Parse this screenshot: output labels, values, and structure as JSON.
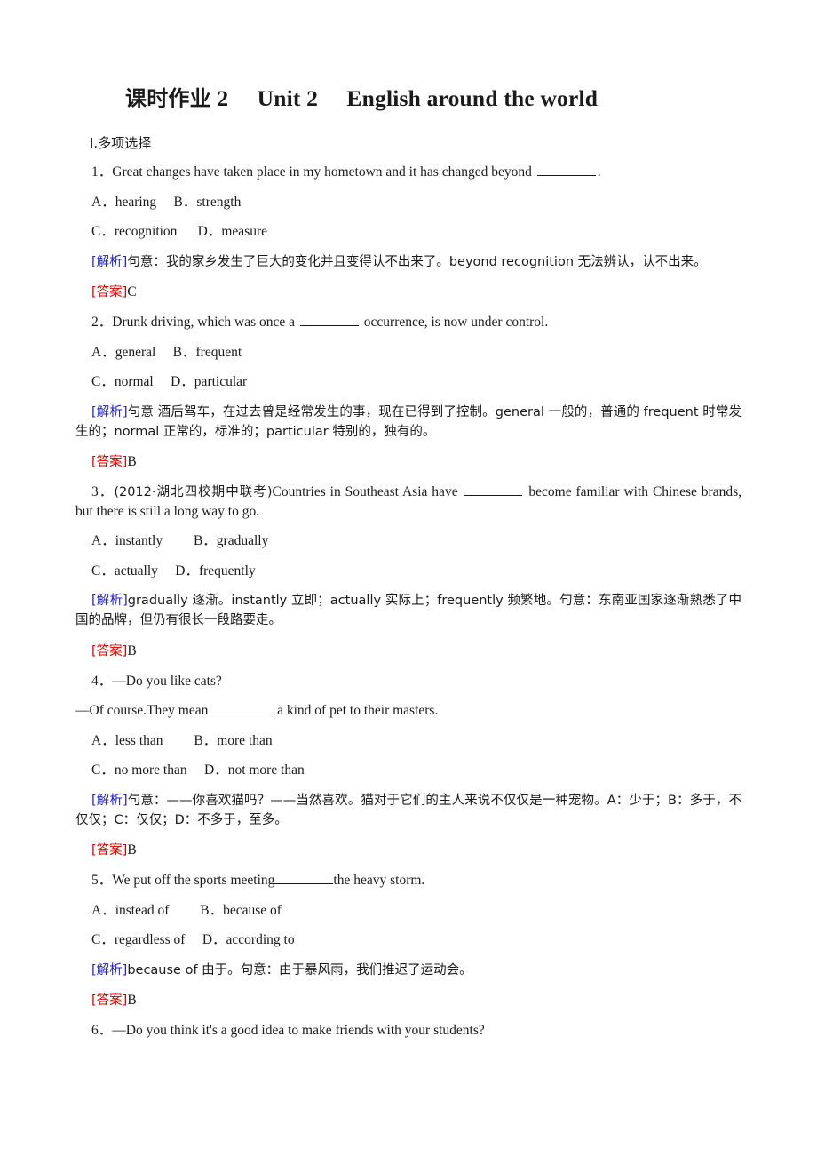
{
  "title": {
    "prefix_cn": "课时作业",
    "number": "2",
    "unit": "Unit 2",
    "unit_name": "English around the world",
    "full": "课时作业 2　Unit 2　English around the world"
  },
  "section": {
    "label": "Ⅰ.多项选择"
  },
  "labels": {
    "analysis": "[解析]",
    "answer": "[答案]"
  },
  "colors": {
    "analysis_tag": "#2222cc",
    "answer_tag": "#dd0000",
    "text": "#1a1a1a",
    "background": "#ffffff"
  },
  "questions": [
    {
      "number": "1．",
      "stem_before": "Great changes have taken place in my hometown and it has changed beyond ",
      "stem_after": ".",
      "options_line1": "A．hearing　 B．strength",
      "options_line2": "C．recognition　  D．measure",
      "analysis": "句意：我的家乡发生了巨大的变化并且变得认不出来了。beyond recognition 无法辨认，认不出来。",
      "answer": "C"
    },
    {
      "number": "2．",
      "stem_before": "Drunk driving, which was once a ",
      "stem_after": " occurrence, is now under control.",
      "options_line1": "A．general　 B．frequent",
      "options_line2": "C．normal　 D．particular",
      "analysis": "句意 酒后驾车，在过去曾是经常发生的事，现在已得到了控制。general 一般的，普通的 frequent 时常发生的；normal 正常的，标准的；particular 特别的，独有的。",
      "answer": "B"
    },
    {
      "number": "3．",
      "source": "(2012·湖北四校期中联考)",
      "stem_before": "Countries in Southeast Asia have ",
      "stem_after": " become familiar with Chinese brands, but there is still a long way to go.",
      "options_line1": "A．instantly　　 B．gradually",
      "options_line2": "C．actually　 D．frequently",
      "analysis": "gradually 逐渐。instantly 立即；actually 实际上；frequently 频繁地。句意：东南亚国家逐渐熟悉了中国的品牌，但仍有很长一段路要走。",
      "answer": "B"
    },
    {
      "number": "4．",
      "dialogue_line1": "—Do you like cats?",
      "stem_before": "—Of course.They mean ",
      "stem_after": " a kind of pet to their masters.",
      "options_line1": "A．less than　　 B．more than",
      "options_line2": "C．no more than　 D．not more than",
      "analysis": "句意：——你喜欢猫吗？——当然喜欢。猫对于它们的主人来说不仅仅是一种宠物。A：少于；B：多于，不仅仅；C：仅仅；D：不多于，至多。",
      "answer": "B"
    },
    {
      "number": "5．",
      "stem_before": "We put off the sports meeting",
      "stem_after": "the heavy storm.",
      "options_line1": "A．instead of　　 B．because of",
      "options_line2": "C．regardless of　 D．according to",
      "analysis": "because of 由于。句意：由于暴风雨，我们推迟了运动会。",
      "answer": "B"
    },
    {
      "number": "6．",
      "dialogue_line1": "—Do you think it's a good idea to make friends with your students?"
    }
  ]
}
